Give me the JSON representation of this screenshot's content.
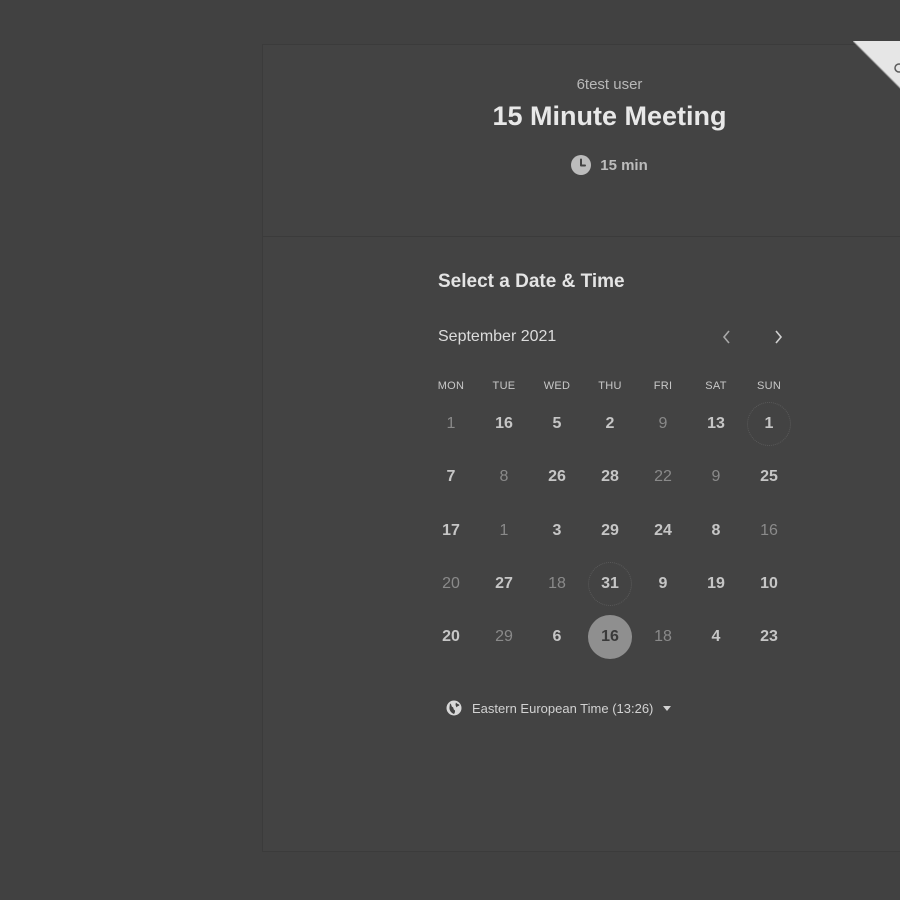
{
  "event": {
    "organizer": "6test user",
    "title": "15 Minute Meeting",
    "duration": "15 min"
  },
  "scheduler": {
    "heading": "Select a Date & Time",
    "month": "September 2021",
    "weekdays": [
      "MON",
      "TUE",
      "WED",
      "THU",
      "FRI",
      "SAT",
      "SUN"
    ],
    "weeks": [
      [
        {
          "label": "1",
          "available": false
        },
        {
          "label": "16",
          "available": true
        },
        {
          "label": "5",
          "available": true
        },
        {
          "label": "2",
          "available": true
        },
        {
          "label": "9",
          "available": false
        },
        {
          "label": "13",
          "available": true
        },
        {
          "label": "1",
          "available": true,
          "today": true
        }
      ],
      [
        {
          "label": "7",
          "available": true
        },
        {
          "label": "8",
          "available": false
        },
        {
          "label": "26",
          "available": true
        },
        {
          "label": "28",
          "available": true
        },
        {
          "label": "22",
          "available": false
        },
        {
          "label": "9",
          "available": false
        },
        {
          "label": "25",
          "available": true
        }
      ],
      [
        {
          "label": "17",
          "available": true
        },
        {
          "label": "1",
          "available": false
        },
        {
          "label": "3",
          "available": true
        },
        {
          "label": "29",
          "available": true
        },
        {
          "label": "24",
          "available": true
        },
        {
          "label": "8",
          "available": true
        },
        {
          "label": "16",
          "available": false
        }
      ],
      [
        {
          "label": "20",
          "available": false
        },
        {
          "label": "27",
          "available": true
        },
        {
          "label": "18",
          "available": false
        },
        {
          "label": "31",
          "available": true,
          "today": true
        },
        {
          "label": "9",
          "available": true
        },
        {
          "label": "19",
          "available": true
        },
        {
          "label": "10",
          "available": true
        }
      ],
      [
        {
          "label": "20",
          "available": true
        },
        {
          "label": "29",
          "available": false
        },
        {
          "label": "6",
          "available": true
        },
        {
          "label": "16",
          "available": true,
          "selected": true
        },
        {
          "label": "18",
          "available": false
        },
        {
          "label": "4",
          "available": true
        },
        {
          "label": "23",
          "available": true
        }
      ]
    ]
  },
  "timezone": {
    "label": "Eastern European Time (13:26)"
  },
  "icons": {
    "clock": "clock-icon",
    "globe": "globe-icon",
    "prev": "chevron-left-icon",
    "next": "chevron-right-icon",
    "caret": "caret-down-icon"
  },
  "colors": {
    "background": "#414141",
    "selected_day": "#8f8f8f"
  }
}
